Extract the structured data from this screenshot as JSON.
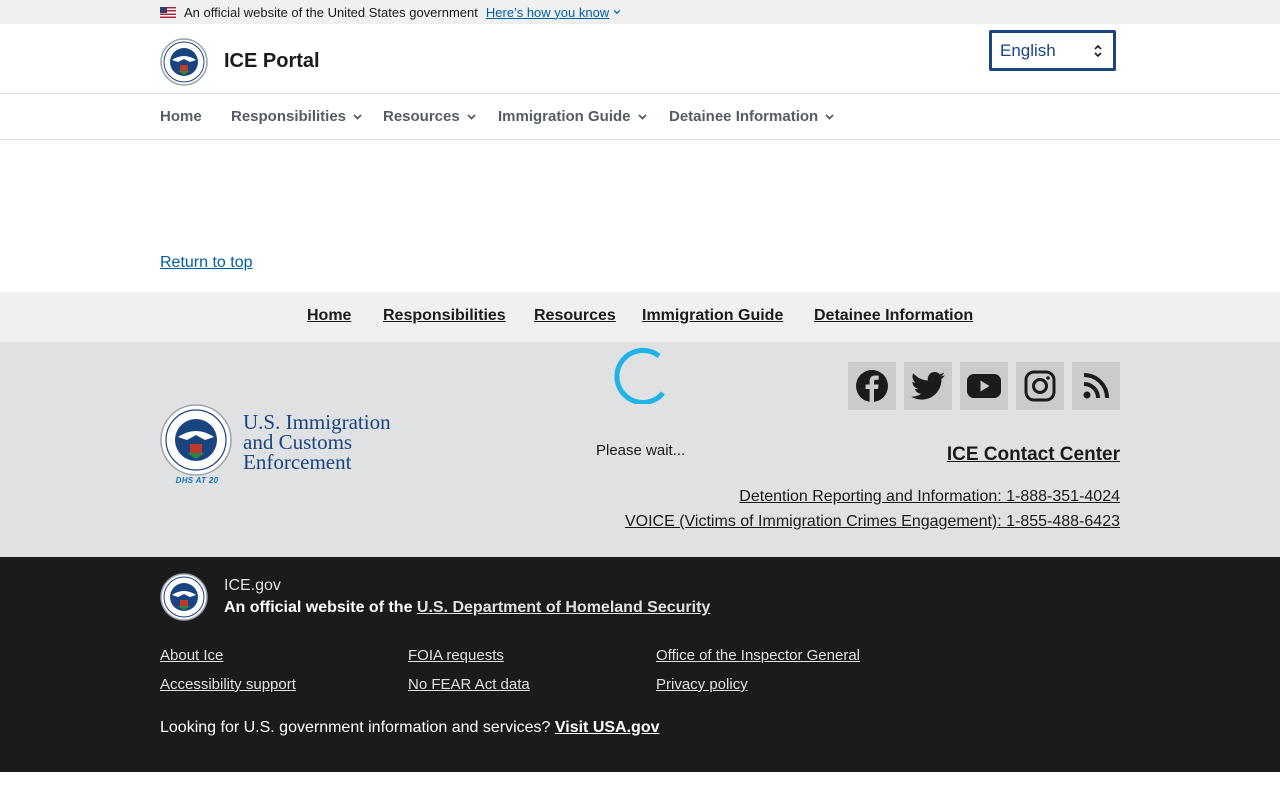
{
  "gov_banner": {
    "text": "An official website of the United States government",
    "how_link": "Here’s how you know"
  },
  "header": {
    "site_title": "ICE Portal",
    "language": "English"
  },
  "nav": {
    "items": [
      {
        "label": "Home"
      },
      {
        "label": "Responsibilities"
      },
      {
        "label": "Resources"
      },
      {
        "label": "Immigration Guide"
      },
      {
        "label": "Detainee Information"
      }
    ]
  },
  "main": {
    "return_to_top": "Return to top"
  },
  "footer_nav": {
    "items": [
      {
        "label": "Home"
      },
      {
        "label": "Responsibilities"
      },
      {
        "label": "Resources"
      },
      {
        "label": "Immigration Guide"
      },
      {
        "label": "Detainee Information"
      }
    ]
  },
  "footer_logo": {
    "line1": "U.S. Immigration",
    "line2": "and Customs",
    "line3": "Enforcement",
    "badge": "DHS AT 20"
  },
  "loading": {
    "text": "Please wait..."
  },
  "social": [
    "facebook-icon",
    "twitter-icon",
    "youtube-icon",
    "instagram-icon",
    "rss-icon"
  ],
  "contact": {
    "title": "ICE Contact Center",
    "detention": "Detention Reporting and Information: 1-888-351-4024",
    "voice": "VOICE (Victims of Immigration Crimes Engagement): 1-855-488-6423"
  },
  "identifier": {
    "domain": "ICE.gov",
    "official_prefix": "An official website of the ",
    "dhs_link": "U.S. Department of Homeland Security",
    "links": [
      {
        "label": "About Ice"
      },
      {
        "label": "FOIA requests"
      },
      {
        "label": "Office of the Inspector General"
      },
      {
        "label": "Accessibility support"
      },
      {
        "label": "No FEAR Act data"
      },
      {
        "label": "Privacy policy"
      }
    ],
    "usa_prefix": "Looking for U.S. government information and services? ",
    "usa_link": "Visit USA.gov"
  },
  "colors": {
    "link_blue": "#005ea2",
    "primary_dark": "#1a4480",
    "spinner": "#1fb3e8",
    "footer_gray": "#dfe1e2",
    "identifier_bg": "#1b1b1b"
  }
}
